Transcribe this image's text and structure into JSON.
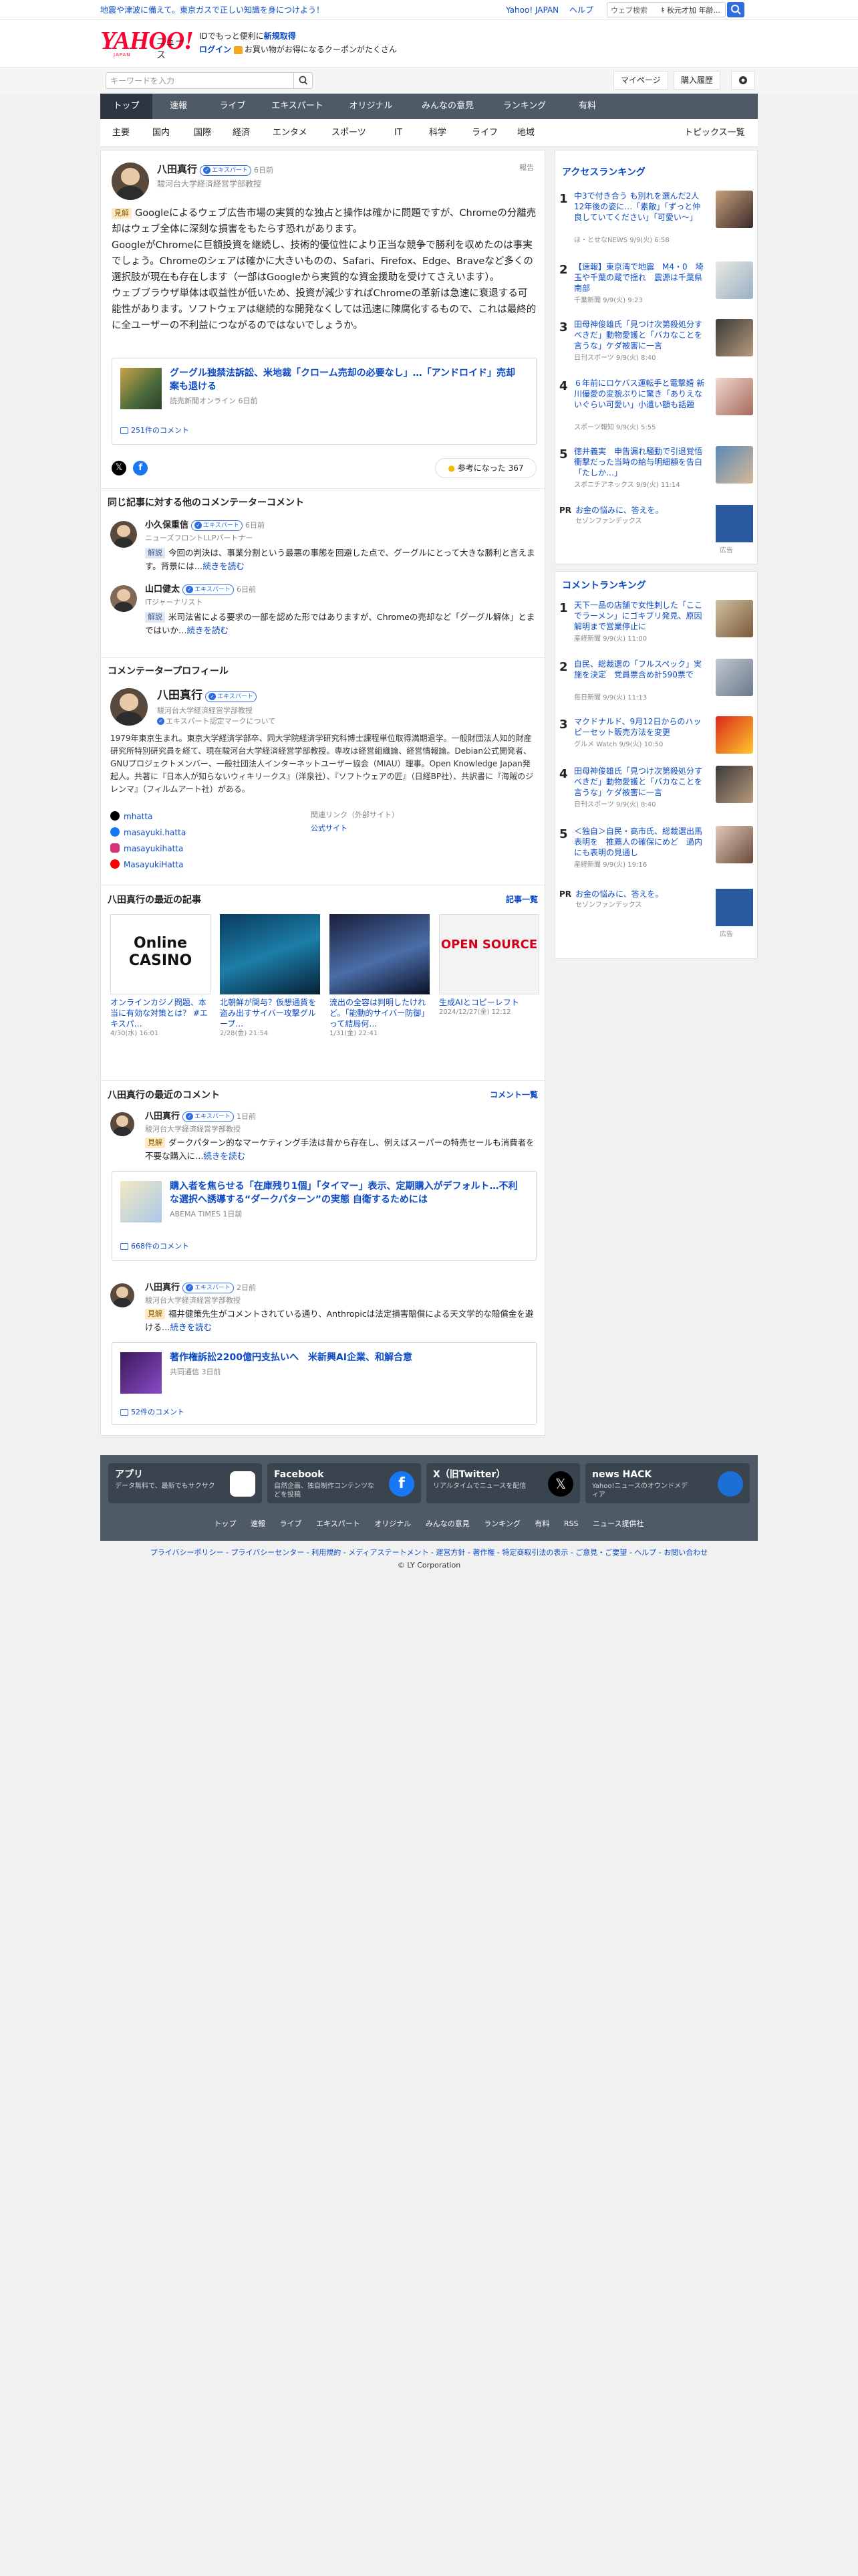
{
  "top_strip": {
    "message": "地震や津波に備えて。東京ガスで正しい知識を身につけよう！",
    "link_home": "Yahoo! JAPAN",
    "link_help": "ヘルプ",
    "search_placeholder": "ウェブ検索",
    "search_tab": "ｷ 秋元才加 年齢..."
  },
  "header": {
    "logo": "YAHOO!",
    "logo_sub": "JAPAN",
    "logo_news": "ニュース",
    "promo_line1_a": "ID",
    "promo_line1_b": "でもっと便利に",
    "promo_line1_c": "新規取得",
    "promo_line2_a": "ログイン",
    "promo_line2_b": "お買い物がお得になるクーポンがたくさん"
  },
  "searchbar": {
    "placeholder": "キーワードを入力",
    "mypage": "マイページ",
    "history": "購入履歴"
  },
  "global_nav": [
    "トップ",
    "速報",
    "ライブ",
    "エキスパート",
    "オリジナル",
    "みんなの意見",
    "ランキング",
    "有料"
  ],
  "sub_nav": [
    "主要",
    "国内",
    "国際",
    "経済",
    "エンタメ",
    "スポーツ",
    "IT",
    "科学",
    "ライフ",
    "地域"
  ],
  "sub_nav_right": "トピックス一覧",
  "comment": {
    "author": "八田真行",
    "badge": "エキスパート",
    "time": "6日前",
    "report": "報告",
    "affiliation": "駿河台大学経済経営学部教授",
    "tag": "見解",
    "body": "Googleによるウェブ広告市場の実質的な独占と操作は確かに問題ですが、Chromeの分離売却はウェブ全体に深刻な損害をもたらす恐れがあります。\nGoogleがChromeに巨額投資を継続し、技術的優位性により正当な競争で勝利を収めたのは事実でしょう。Chromeのシェアは確かに大きいものの、Safari、Firefox、Edge、Braveなど多くの選択肢が現在も存在します（一部はGoogleから実質的な資金援助を受けてさえいます）。\nウェブブラウザ単体は収益性が低いため、投資が減少すればChromeの革新は急速に衰退する可能性があります。ソフトウェアは継続的な開発なくしては迅速に陳腐化するもので、これは最終的に全ユーザーの不利益につながるのではないでしょうか。"
  },
  "linked_article": {
    "title": "グーグル独禁法訴訟、米地裁「クローム売却の必要なし」…「アンドロイド」売却案も退ける",
    "source": "読売新聞オンライン",
    "time": "6日前",
    "comments": "251件のコメント"
  },
  "helpful": {
    "label": "参考になった",
    "count": "367"
  },
  "others": {
    "title": "同じ記事に対する他のコメンテーターコメント",
    "items": [
      {
        "name": "小久保重信",
        "badge": "エキスパート",
        "time": "6日前",
        "role": "ニューズフロントLLPパートナー",
        "tag": "解説",
        "text": "今回の判決は、事業分割という最悪の事態を回避した点で、グーグルにとって大きな勝利と言えます。背景には…",
        "more": "続きを読む"
      },
      {
        "name": "山口健太",
        "badge": "エキスパート",
        "time": "6日前",
        "role": "ITジャーナリスト",
        "tag": "解説",
        "text": "米司法省による要求の一部を認めた形ではありますが、Chromeの売却など「グーグル解体」とまではいか…",
        "more": "続きを読む"
      }
    ]
  },
  "profile": {
    "title": "コメンテータープロフィール",
    "name": "八田真行",
    "badge": "エキスパート",
    "affiliation": "駿河台大学経済経営学部教授",
    "mark_link": "エキスパート認定マークについて",
    "bio": "1979年東京生まれ。東京大学経済学部卒、同大学院経済学研究科博士課程単位取得満期退学。一般財団法人知的財産研究所特別研究員を経て、現在駿河台大学経済経営学部教授。専攻は経営組織論、経営情報論。Debian公式開発者、GNUプロジェクトメンバー、一般社団法人インターネットユーザー協会（MIAU）理事。Open Knowledge Japan発起人。共著に『日本人が知らないウィキリークス』（洋泉社）、『ソフトウェアの匠』（日経BP社）、共訳書に『海賊のジレンマ』（フィルムアート社）がある。",
    "social": [
      "mhatta",
      "masayuki.hatta",
      "masayukihatta",
      "MasayukiHatta"
    ],
    "related_label": "関連リンク（外部サイト）",
    "official": "公式サイト"
  },
  "articles": {
    "title": "八田真行の最近の記事",
    "more": "記事一覧",
    "items": [
      {
        "title": "オンラインカジノ問題、本当に有効な対策とは？ #エキスパ…",
        "date": "4/30(水) 16:01",
        "img_text": "Online CASINO"
      },
      {
        "title": "北朝鮮が関与？仮想通貨を盗み出すサイバー攻撃グループ…",
        "date": "2/28(金) 21:54",
        "img_text": ""
      },
      {
        "title": "流出の全容は判明したけれど。「能動的サイバー防御」って結局何…",
        "date": "1/31(金) 22:41",
        "img_text": ""
      },
      {
        "title": "生成AIとコピーレフト",
        "date": "2024/12/27(金) 12:12",
        "img_text": "OPEN SOURCE"
      }
    ]
  },
  "recent": {
    "title": "八田真行の最近のコメント",
    "more": "コメント一覧",
    "items": [
      {
        "name": "八田真行",
        "badge": "エキスパート",
        "time": "1日前",
        "role": "駿河台大学経済経営学部教授",
        "tag": "見解",
        "text": "ダークパターン的なマーケティング手法は昔から存在し、例えばスーパーの特売セールも消費者を不要な購入に…",
        "more": "続きを読む",
        "art_title": "購入者を焦らせる「在庫残り1個」「タイマー」表示、定期購入がデフォルト…不利な選択へ誘導する“ダークパターン”の実態 自衛するためには",
        "art_source": "ABEMA TIMES",
        "art_time": "1日前",
        "art_comments": "668件のコメント"
      },
      {
        "name": "八田真行",
        "badge": "エキスパート",
        "time": "2日前",
        "role": "駿河台大学経済経営学部教授",
        "tag": "見解",
        "text": "福井健策先生がコメントされている通り、Anthropicは法定損害賠償による天文学的な賠償金を避ける…",
        "more": "続きを読む",
        "art_title": "著作権訴訟2200億円支払いへ　米新興AI企業、和解合意",
        "art_source": "共同通信",
        "art_time": "3日前",
        "art_comments": "52件のコメント"
      }
    ]
  },
  "access_ranking": {
    "title": "アクセスランキング",
    "items": [
      {
        "n": "1",
        "t": "中3で付き合う も別れを選んだ2人 12年後の姿に…「素敵」「ずっと仲良していてください」「可愛い〜」",
        "m": "ほ・とせなNEWS 9/9(火) 6:58"
      },
      {
        "n": "2",
        "t": "【速報】東京湾で地震　M4・0　埼玉や千葉の蔵で揺れ　震源は千葉県南部",
        "m": "千葉新聞 9/9(火) 9:23"
      },
      {
        "n": "3",
        "t": "田母神俊雄氏「見つけ次第殺処分すべきだ」動物愛護と「バカなことを言うな」ケダ被害に一言",
        "m": "日刊スポーツ 9/9(火) 8:40"
      },
      {
        "n": "4",
        "t": "６年前にロケバス運転手と電撃婚 新川優愛の変貌ぶりに驚き「ありえないぐらい可愛い」小遣い額も話題",
        "m": "スポーツ報知 9/9(火) 5:55"
      },
      {
        "n": "5",
        "t": "徳井義実　申告漏れ騒動で引退覚悟　衝撃だった当時の給与明細額を告白「たしか…」",
        "m": "スポニチアネックス 9/9(火) 11:14"
      }
    ],
    "pr_text": "お金の悩みに、答えを。",
    "pr_sponsor": "セゾンファンデックス",
    "pr_label": "広告"
  },
  "comment_ranking": {
    "title": "コメントランキング",
    "items": [
      {
        "n": "1",
        "t": "天下一品の店舗で女性刺した「ここでラーメン」にゴキブリ発見、原因解明まで営業停止に",
        "m": "産経新聞 9/9(火) 11:00"
      },
      {
        "n": "2",
        "t": "自民、総裁選の「フルスペック」実施を決定　党員票含め計590票で",
        "m": "毎日新聞 9/9(火) 11:13"
      },
      {
        "n": "3",
        "t": "マクドナルド、9月12日からのハッピーセット販売方法を変更",
        "m": "グルメ Watch 9/9(火) 10:50"
      },
      {
        "n": "4",
        "t": "田母神俊雄氏「見つけ次第殺処分すべきだ」動物愛護と「バカなことを言うな」ケダ被害に一言",
        "m": "日刊スポーツ 9/9(火) 8:40"
      },
      {
        "n": "5",
        "t": "＜独自＞自民・高市氏、総裁選出馬表明を　推薦人の確保にめど　過内にも表明の見通し",
        "m": "産経新聞 9/9(火) 19:16"
      }
    ],
    "pr_text": "お金の悩みに、答えを。",
    "pr_sponsor": "セゾンファンデックス",
    "pr_label": "広告"
  },
  "footer": {
    "boxes": [
      {
        "t": "アプリ",
        "d": "データ無料で、最新でもサクサク"
      },
      {
        "t": "Facebook",
        "d": "自然企画、独自制作コンテンツなどを投稿"
      },
      {
        "t": "X（旧Twitter）",
        "d": "リアルタイムでニュースを配信"
      },
      {
        "t": "news HACK",
        "d": "Yahoo!ニュースのオウンドメディア"
      }
    ],
    "links": [
      "トップ",
      "速報",
      "ライブ",
      "エキスパート",
      "オリジナル",
      "みんなの意見",
      "ランキング",
      "有料",
      "RSS",
      "ニュース提供社"
    ],
    "bottom_links": "プライバシーポリシー - プライバシーセンター - 利用規約 - メディアステートメント - 運営方針 - 著作権 - 特定商取引法の表示 - ご意見・ご要望 - ヘルプ - お問い合わせ",
    "copyright": "© LY Corporation"
  },
  "colors": {
    "nav": "#4e5a66",
    "accent": "#2f6de1",
    "logo": "#ff0033"
  }
}
